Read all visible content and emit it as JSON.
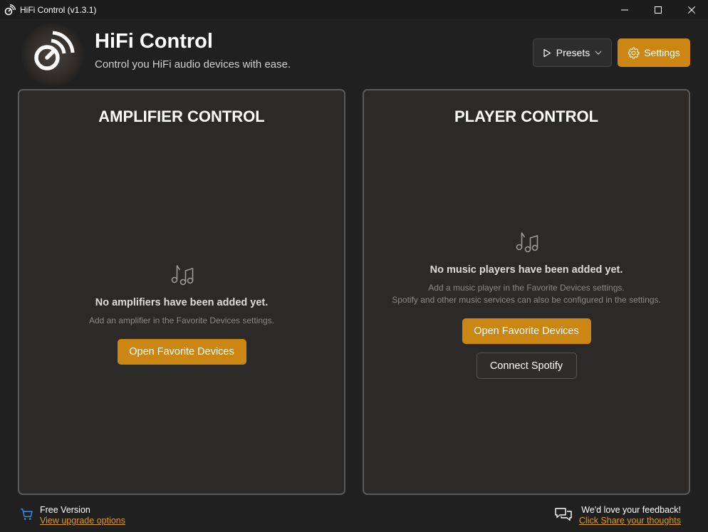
{
  "window": {
    "title": "HiFi Control (v1.3.1)"
  },
  "header": {
    "app_name": "HiFi Control",
    "tagline": "Control you HiFi audio devices with ease.",
    "presets_label": "Presets",
    "settings_label": "Settings"
  },
  "amplifier": {
    "title": "AMPLIFIER CONTROL",
    "empty_title": "No amplifiers have been added yet.",
    "empty_desc": "Add an amplifier in the Favorite Devices settings.",
    "open_favorites_label": "Open Favorite Devices"
  },
  "player": {
    "title": "PLAYER CONTROL",
    "empty_title": "No music players have been added yet.",
    "empty_desc_line1": "Add a music player in the Favorite Devices settings.",
    "empty_desc_line2": "Spotify and other music services can also be configured in the settings.",
    "open_favorites_label": "Open Favorite Devices",
    "connect_spotify_label": "Connect Spotify"
  },
  "footer": {
    "version_label": "Free Version",
    "upgrade_link": "View upgrade options",
    "feedback_label": "We'd love your feedback!",
    "feedback_link": "Click Share your thoughts"
  },
  "colors": {
    "accent": "#cc8613",
    "background": "#202020",
    "panel": "#2c2a28",
    "link": "#e09a1c"
  },
  "icons": [
    "app-logo-icon",
    "minimize-icon",
    "maximize-icon",
    "close-icon",
    "play-icon",
    "chevron-down-icon",
    "gear-icon",
    "music-notes-icon",
    "cart-icon",
    "chat-bubbles-icon"
  ]
}
